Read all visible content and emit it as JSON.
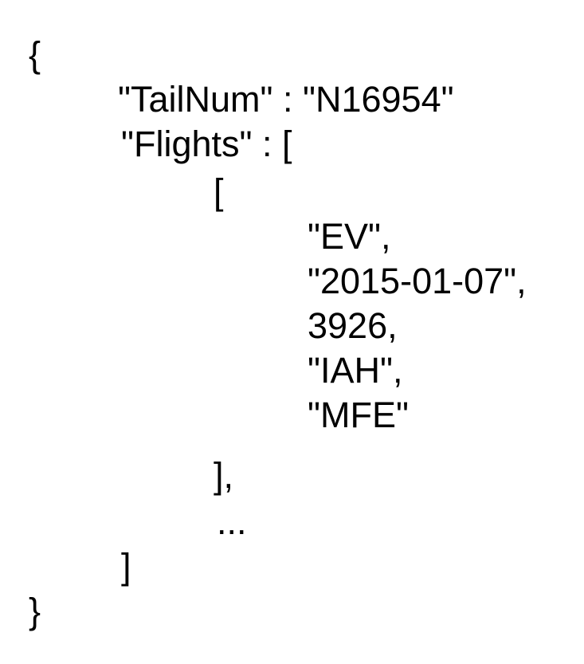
{
  "document": {
    "open_brace": "{",
    "tailnum_line": "\"TailNum\" : \"N16954\"",
    "flights_line": "\"Flights\" : [",
    "inner_open": "[",
    "values": [
      "\"EV\",",
      "\"2015-01-07\",",
      "3926,",
      "\"IAH\",",
      "\"MFE\""
    ],
    "inner_close": "],",
    "ellipsis": "...",
    "outer_close": "]",
    "close_brace": "}"
  }
}
